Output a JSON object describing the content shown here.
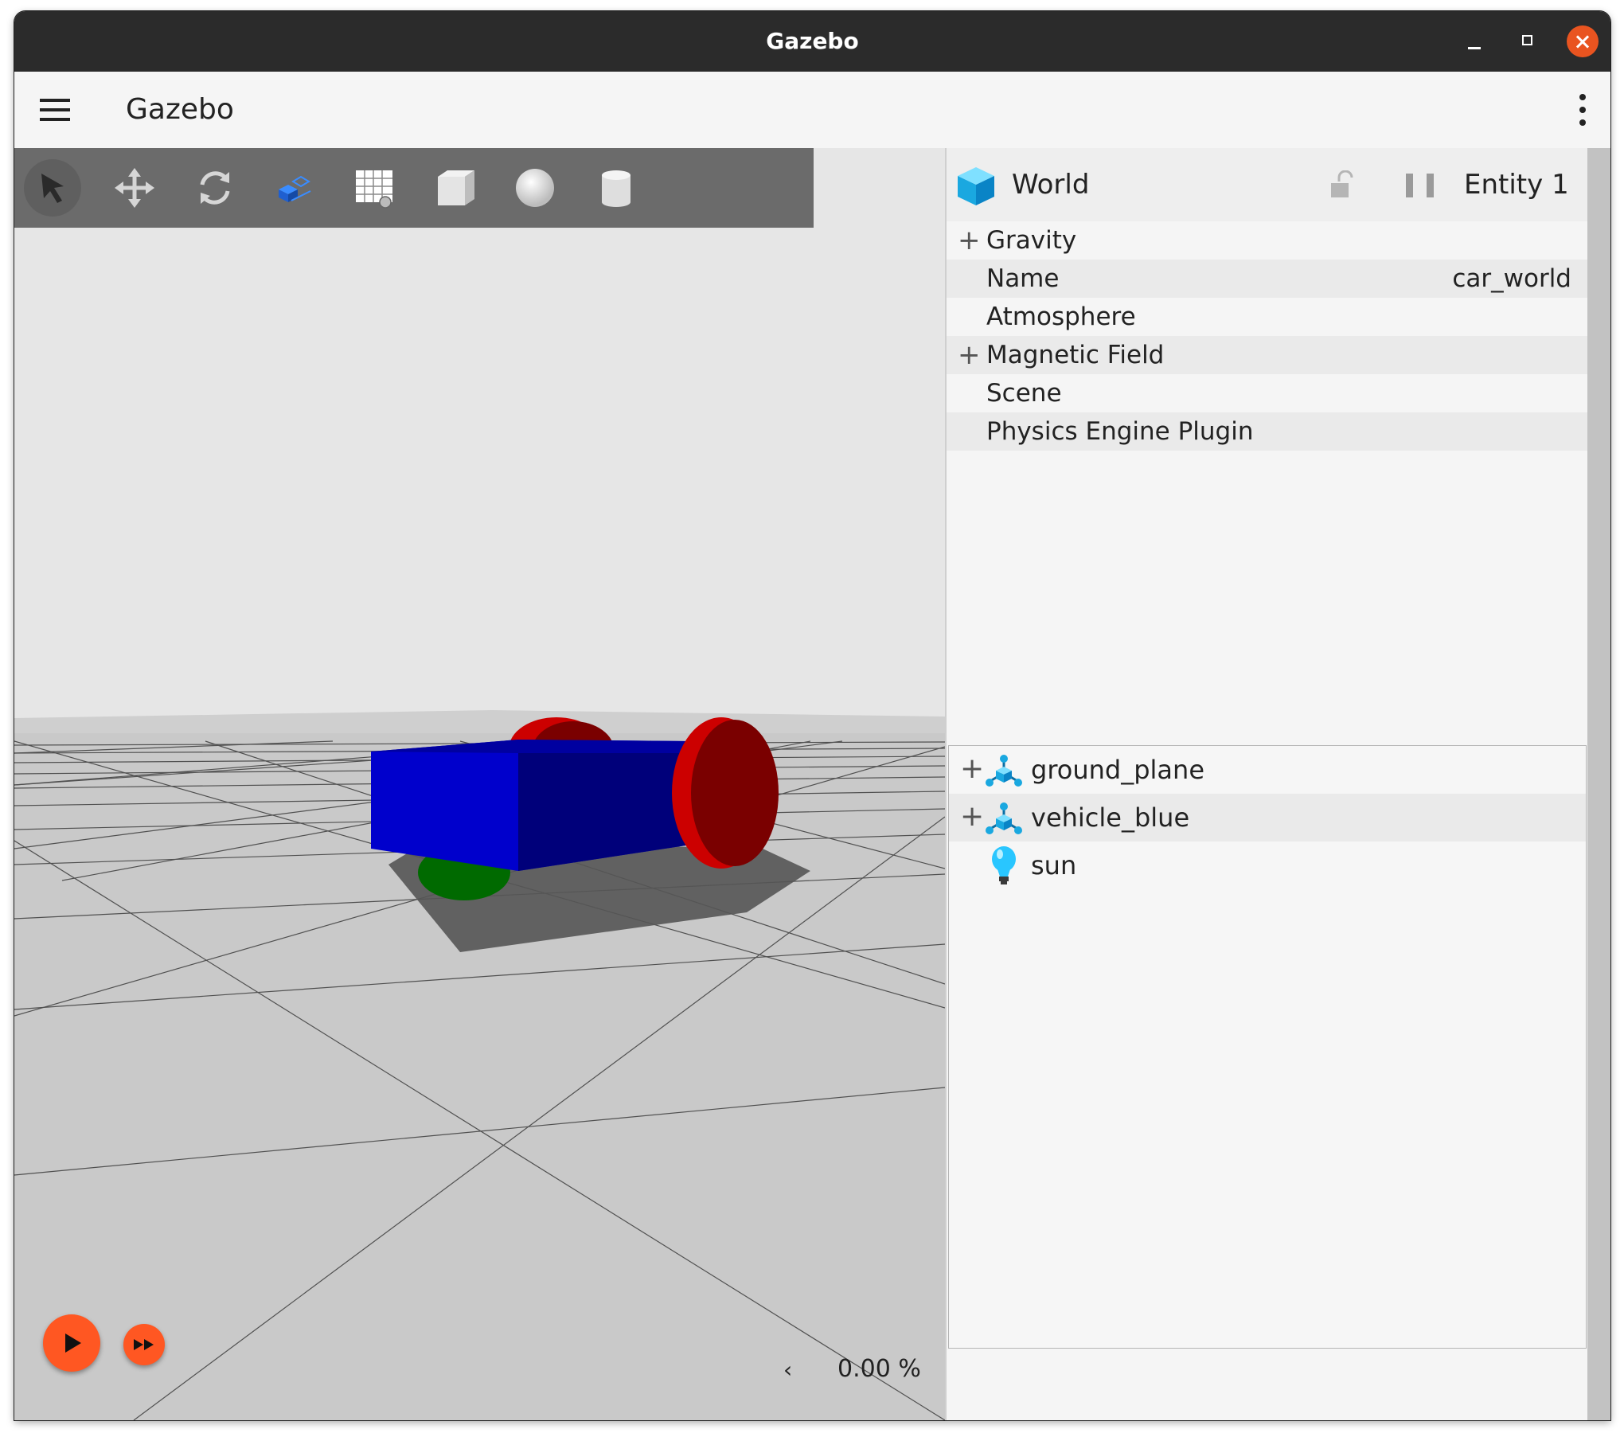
{
  "window": {
    "title": "Gazebo",
    "accent_color": "#e95420"
  },
  "appbar": {
    "title": "Gazebo",
    "menu_icon": "hamburger-icon",
    "overflow_icon": "kebab-menu-icon"
  },
  "toolbar": {
    "tools": [
      {
        "name": "select",
        "icon": "arrow-cursor-icon",
        "active": true
      },
      {
        "name": "translate",
        "icon": "move-arrows-icon"
      },
      {
        "name": "rotate",
        "icon": "rotate-arrows-icon"
      },
      {
        "name": "transform-control",
        "icon": "transform-box-icon"
      },
      {
        "name": "grid-config",
        "icon": "grid-icon"
      },
      {
        "name": "box",
        "icon": "box-shape-icon"
      },
      {
        "name": "sphere",
        "icon": "sphere-shape-icon"
      },
      {
        "name": "cylinder",
        "icon": "cylinder-shape-icon"
      }
    ]
  },
  "playback": {
    "play_icon": "play-icon",
    "step_icon": "fast-forward-icon",
    "collapse_icon": "chevron-left-icon",
    "real_time_factor": "0.00 %",
    "accent_color": "#ff5722"
  },
  "component_inspector": {
    "entity_type": "World",
    "entity_label": "Entity 1",
    "lock_icon": "unlock-icon",
    "pause_icon": "pause-icon",
    "properties": [
      {
        "label": "Gravity",
        "value": "",
        "expandable": true
      },
      {
        "label": "Name",
        "value": "car_world",
        "expandable": false
      },
      {
        "label": "Atmosphere",
        "value": "",
        "expandable": false
      },
      {
        "label": "Magnetic Field",
        "value": "",
        "expandable": true
      },
      {
        "label": "Scene",
        "value": "",
        "expandable": false
      },
      {
        "label": "Physics Engine Plugin",
        "value": "",
        "expandable": false
      }
    ]
  },
  "entity_tree": {
    "items": [
      {
        "label": "ground_plane",
        "icon": "model-icon",
        "expandable": true
      },
      {
        "label": "vehicle_blue",
        "icon": "model-icon",
        "expandable": true
      },
      {
        "label": "sun",
        "icon": "light-bulb-icon",
        "expandable": false
      }
    ]
  },
  "scene": {
    "sky_color": "#e6e6e6",
    "ground_color": "#c9c9c9",
    "chassis_color": "#0000cc",
    "wheel_color": "#cc0000",
    "caster_color": "#008800"
  }
}
